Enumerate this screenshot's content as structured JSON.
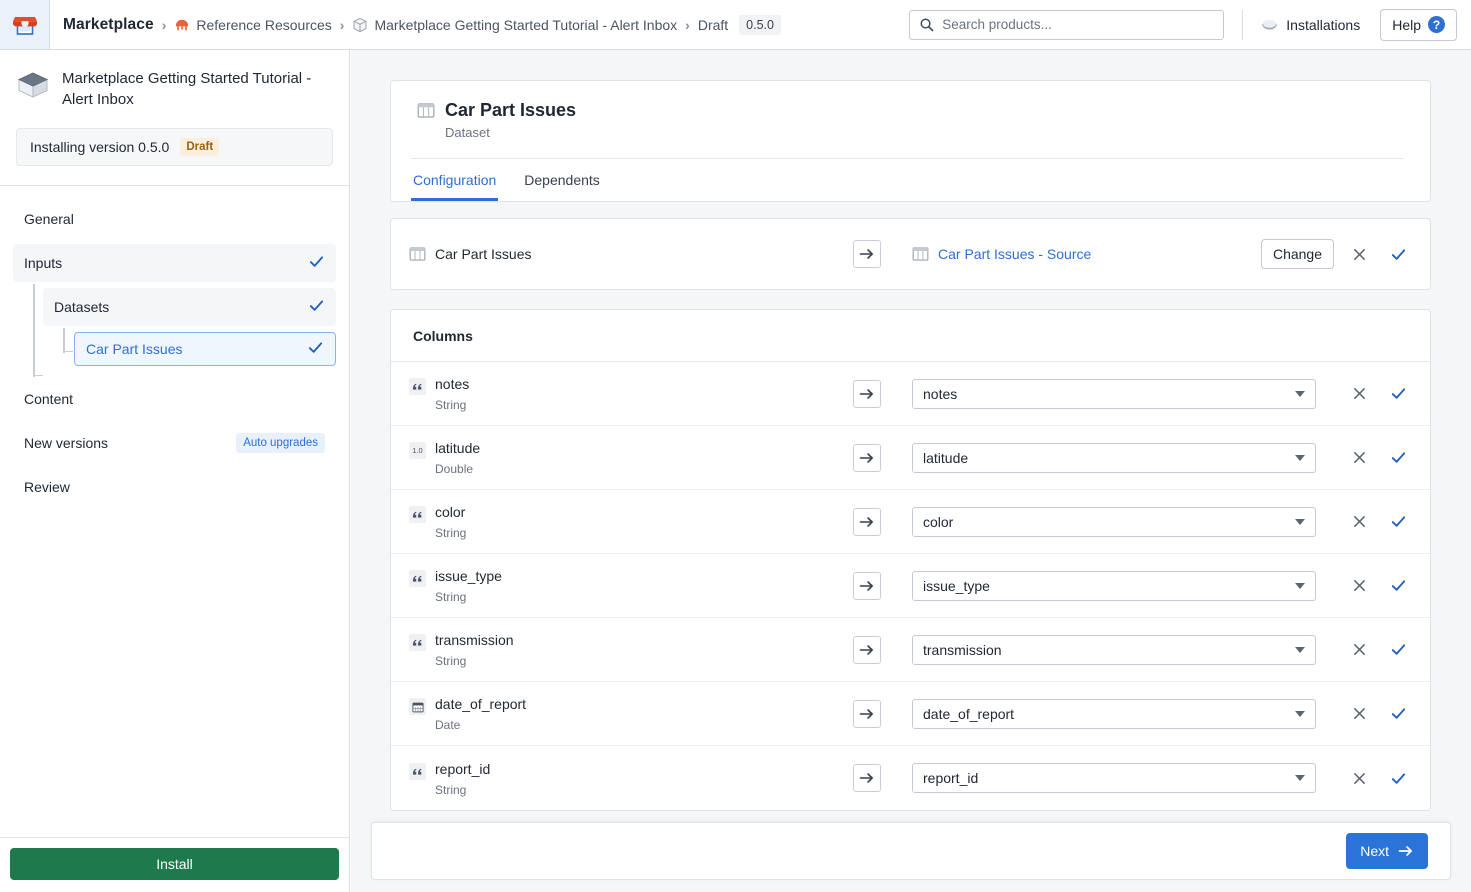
{
  "topbar": {
    "logo_icon": "marketplace-storefront-icon",
    "breadcrumb": {
      "root": "Marketplace",
      "separator": "›",
      "items": [
        {
          "label": "Reference Resources",
          "icon": "reference-resources-icon"
        },
        {
          "label": "Marketplace Getting Started Tutorial - Alert Inbox",
          "icon": "product-cube-icon"
        }
      ],
      "status": "Draft",
      "version": "0.5.0"
    },
    "search": {
      "placeholder": "Search products...",
      "value": "",
      "icon": "search-icon"
    },
    "installations": {
      "label": "Installations",
      "icon": "installations-globe-icon"
    },
    "help": {
      "label": "Help",
      "icon": "question-mark-icon"
    }
  },
  "sidebar": {
    "product_icon": "product-cube-icon",
    "product_title": "Marketplace Getting Started Tutorial - Alert Inbox",
    "installing_text": "Installing version 0.5.0",
    "installing_badge": "Draft",
    "nav": [
      {
        "label": "General",
        "level": 0,
        "selected": false,
        "checked": false
      },
      {
        "label": "Inputs",
        "level": 0,
        "selected": true,
        "checked": true
      },
      {
        "label": "Datasets",
        "level": 1,
        "selected": true,
        "checked": true
      },
      {
        "label": "Car Part Issues",
        "level": 2,
        "selected": true,
        "checked": true,
        "active": true
      },
      {
        "label": "Content",
        "level": 0,
        "selected": false,
        "checked": false
      },
      {
        "label": "New versions",
        "level": 0,
        "selected": false,
        "checked": false,
        "badge": "Auto upgrades"
      },
      {
        "label": "Review",
        "level": 0,
        "selected": false,
        "checked": false
      }
    ],
    "install_button": "Install"
  },
  "main": {
    "dataset": {
      "icon": "table-dataset-icon",
      "title": "Car Part Issues",
      "subtitle": "Dataset"
    },
    "tabs": [
      {
        "label": "Configuration",
        "active": true
      },
      {
        "label": "Dependents",
        "active": false
      }
    ],
    "mapping": {
      "source_label": "Car Part Issues",
      "source_icon": "table-dataset-icon",
      "arrow_icon": "arrow-right-icon",
      "target_label": "Car Part Issues - Source",
      "target_icon": "table-dataset-icon",
      "change_label": "Change",
      "clear_icon": "close-x-icon",
      "confirm_icon": "check-icon"
    },
    "columns_header": "Columns",
    "columns": [
      {
        "name": "notes",
        "type": "String",
        "type_icon": "string-quote-icon",
        "mapped_value": "notes"
      },
      {
        "name": "latitude",
        "type": "Double",
        "type_icon": "double-number-icon",
        "mapped_value": "latitude"
      },
      {
        "name": "color",
        "type": "String",
        "type_icon": "string-quote-icon",
        "mapped_value": "color"
      },
      {
        "name": "issue_type",
        "type": "String",
        "type_icon": "string-quote-icon",
        "mapped_value": "issue_type"
      },
      {
        "name": "transmission",
        "type": "String",
        "type_icon": "string-quote-icon",
        "mapped_value": "transmission"
      },
      {
        "name": "date_of_report",
        "type": "Date",
        "type_icon": "calendar-date-icon",
        "mapped_value": "date_of_report"
      },
      {
        "name": "report_id",
        "type": "String",
        "type_icon": "string-quote-icon",
        "mapped_value": "report_id"
      }
    ],
    "next_button": "Next",
    "next_icon": "arrow-right-icon"
  },
  "colors": {
    "accent_blue": "#2f6fd0",
    "next_blue": "#2a74d8",
    "install_green": "#1d7a4c",
    "draft_amber_bg": "#fbeedd",
    "draft_amber_text": "#9a6212",
    "logo_orange": "#e04e2a",
    "page_bg": "#f4f6f8"
  }
}
